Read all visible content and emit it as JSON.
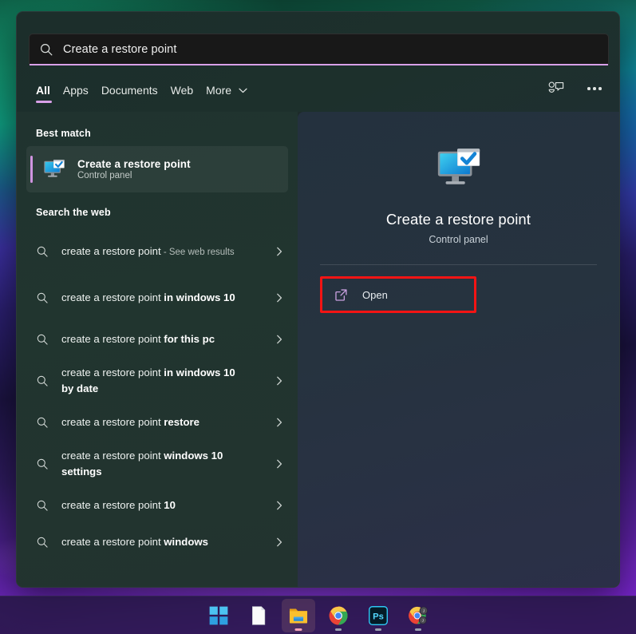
{
  "search": {
    "query": "Create a restore point",
    "icon": "search-icon"
  },
  "tabs": [
    {
      "label": "All",
      "active": true,
      "has_chevron": false
    },
    {
      "label": "Apps",
      "active": false,
      "has_chevron": false
    },
    {
      "label": "Documents",
      "active": false,
      "has_chevron": false
    },
    {
      "label": "Web",
      "active": false,
      "has_chevron": false
    },
    {
      "label": "More",
      "active": false,
      "has_chevron": true
    }
  ],
  "header_actions": [
    {
      "name": "feedback-icon"
    },
    {
      "name": "more-options-icon"
    }
  ],
  "results": {
    "best_match_heading": "Best match",
    "best_match": {
      "title": "Create a restore point",
      "subtitle": "Control panel",
      "icon": "restore-point-icon"
    },
    "web_heading": "Search the web",
    "web_items": [
      {
        "prefix": "create a restore point",
        "suffix": " - See web results",
        "suffix_style": "muted",
        "two_line": true
      },
      {
        "prefix": "create a restore point ",
        "suffix": "in windows 10",
        "suffix_style": "bold",
        "two_line": true
      },
      {
        "prefix": "create a restore point ",
        "suffix": "for this pc",
        "suffix_style": "bold",
        "two_line": false
      },
      {
        "prefix": "create a restore point ",
        "suffix": "in windows 10 by date",
        "suffix_style": "bold",
        "two_line": true
      },
      {
        "prefix": "create a restore point ",
        "suffix": "restore",
        "suffix_style": "bold",
        "two_line": false
      },
      {
        "prefix": "create a restore point ",
        "suffix": "windows 10 settings",
        "suffix_style": "bold",
        "two_line": true
      },
      {
        "prefix": "create a restore point ",
        "suffix": "10",
        "suffix_style": "bold",
        "two_line": false
      },
      {
        "prefix": "create a restore point ",
        "suffix": "windows",
        "suffix_style": "bold",
        "two_line": false
      }
    ]
  },
  "preview": {
    "title": "Create a restore point",
    "subtitle": "Control panel",
    "icon": "restore-point-icon",
    "actions": [
      {
        "label": "Open",
        "icon": "open-external-icon",
        "highlighted": true
      }
    ]
  },
  "taskbar": [
    {
      "name": "start-button",
      "active": false,
      "indicator": "none"
    },
    {
      "name": "document-app",
      "active": false,
      "indicator": "none"
    },
    {
      "name": "file-explorer-app",
      "active": true,
      "indicator": "accent"
    },
    {
      "name": "chrome-app",
      "active": false,
      "indicator": "normal"
    },
    {
      "name": "photoshop-app",
      "active": false,
      "indicator": "normal"
    },
    {
      "name": "chrome-profile-app",
      "active": false,
      "indicator": "normal",
      "badges": [
        "J",
        "J"
      ]
    }
  ],
  "colors": {
    "accent_pink": "#d8a0e8",
    "highlight_red": "#f41414",
    "panel_left": "#21352f",
    "panel_right": "#26333f",
    "text_primary": "#ffffff",
    "text_secondary": "#c3cbc8"
  }
}
